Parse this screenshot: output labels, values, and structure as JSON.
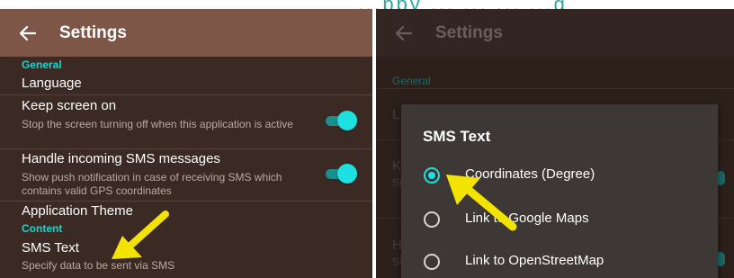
{
  "caption": "...ppy ... ... ... ...g",
  "left_screen": {
    "appbar": {
      "title": "Settings",
      "back_icon": "arrow-left-icon"
    },
    "categories": {
      "general": "General",
      "content": "Content"
    },
    "prefs": {
      "language": {
        "title": "Language"
      },
      "keep_screen_on": {
        "title": "Keep screen on",
        "summary": "Stop the screen turning off when this application is active",
        "enabled": true
      },
      "handle_sms": {
        "title": "Handle incoming SMS messages",
        "summary": "Show push notification in case of receiving SMS which contains valid GPS coordinates",
        "enabled": true
      },
      "app_theme": {
        "title": "Application Theme"
      },
      "sms_text": {
        "title": "SMS Text",
        "summary": "Specify data to be sent via SMS"
      }
    }
  },
  "right_screen": {
    "appbar": {
      "title": "Settings",
      "back_icon": "arrow-left-icon"
    },
    "background": {
      "category_general": "General",
      "peek_1": "L",
      "peek_2": "K",
      "peek_3": "St",
      "peek_4": "H",
      "peek_5": "Sl"
    },
    "dialog": {
      "title": "SMS Text",
      "options": [
        {
          "label": "Coordinates (Degree)",
          "selected": true
        },
        {
          "label": "Link to Google Maps",
          "selected": false
        },
        {
          "label": "Link to OpenStreetMap",
          "selected": false
        }
      ]
    }
  },
  "colors": {
    "accent": "#1ee0e0",
    "annotation_arrow": "#f2e300",
    "left_appbar": "#7d5648",
    "left_background": "#3b2a24"
  }
}
